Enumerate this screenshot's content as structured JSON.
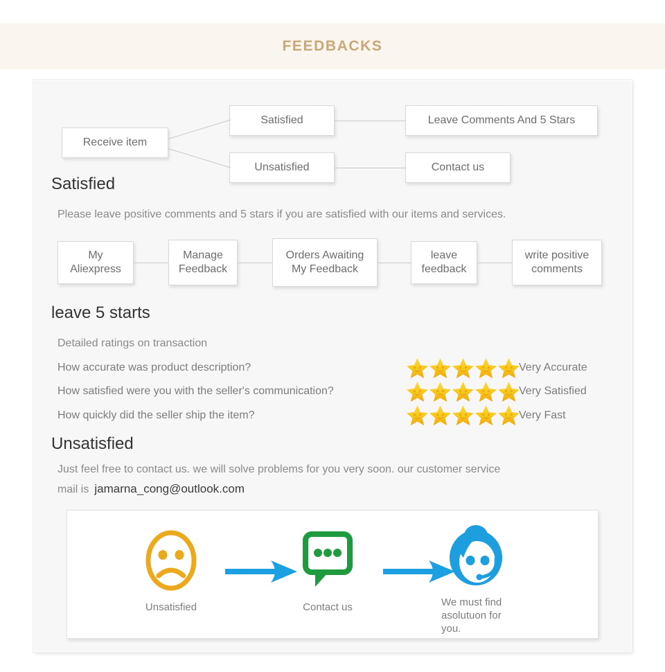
{
  "header": {
    "title": "FEEDBACKS"
  },
  "flow": {
    "start": "Receive item",
    "branch_satisfied": "Satisfied",
    "branch_unsatisfied": "Unsatisfied",
    "result_satisfied": "Leave Comments And 5 Stars",
    "result_unsatisfied": "Contact us"
  },
  "satisfied": {
    "heading": "Satisfied",
    "intro": "Please leave positive comments and 5 stars if you are satisfied with our items and services.",
    "steps": [
      "My\nAliexpress",
      "Manage\nFeedback",
      "Orders Awaiting\nMy Feedback",
      "leave\nfeedback",
      "write positive\ncomments"
    ]
  },
  "ratings": {
    "heading": "leave 5 starts",
    "subtitle": "Detailed ratings on transaction",
    "rows": [
      {
        "question": "How accurate was product description?",
        "stars": 5,
        "label": "Very Accurate"
      },
      {
        "question": "How satisfied were you with the seller's communication?",
        "stars": 5,
        "label": "Very Satisfied"
      },
      {
        "question": "How quickly did the seller ship the item?",
        "stars": 5,
        "label": "Very Fast"
      }
    ]
  },
  "unsatisfied": {
    "heading": "Unsatisfied",
    "line1": "Just feel free to contact us. we will solve problems for you very soon. our customer service",
    "line2_prefix": "mail is",
    "email": "jamarna_cong@outlook.com"
  },
  "strip": {
    "items": [
      {
        "icon": "sad-face-icon",
        "caption": "Unsatisfied"
      },
      {
        "icon": "speech-bubble-icon",
        "caption": "Contact us"
      },
      {
        "icon": "support-agent-icon",
        "caption": "We must find\nasolutuon for\nyou."
      }
    ],
    "arrow_icon": "arrow-right-icon"
  },
  "colors": {
    "header_band": "#faf6ef",
    "header_text": "#c9a877",
    "panel_bg": "#f7f7f7",
    "star": "#f5b914",
    "sad_face": "#eba91d",
    "bubble": "#1f9a3f",
    "agent": "#1d9ede",
    "arrow": "#1ba0e2"
  }
}
